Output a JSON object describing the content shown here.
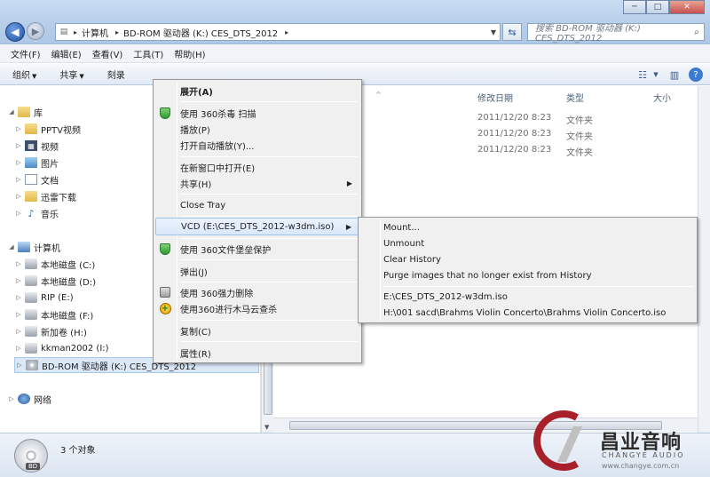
{
  "window": {
    "controls": [
      "─",
      "□",
      "✕"
    ]
  },
  "address_bar": {
    "crumbs": [
      "计算机",
      "BD-ROM 驱动器 (K:) CES_DTS_2012"
    ],
    "search_placeholder": "搜索 BD-ROM 驱动器 (K:) CES_DTS_2012"
  },
  "menubar": {
    "items": [
      "文件(F)",
      "编辑(E)",
      "查看(V)",
      "工具(T)",
      "帮助(H)"
    ]
  },
  "toolbar": {
    "organize": "组织",
    "share": "共享",
    "burn": "刻录"
  },
  "navpane": {
    "libraries": "库",
    "lib_items": [
      "PPTV视频",
      "视频",
      "图片",
      "文档",
      "迅雷下载",
      "音乐"
    ],
    "computer": "计算机",
    "drives": [
      "本地磁盘 (C:)",
      "本地磁盘 (D:)",
      "RIP (E:)",
      "本地磁盘 (F:)",
      "新加卷 (H:)",
      "kkman2002 (I:)",
      "BD-ROM 驱动器 (K:) CES_DTS_2012"
    ],
    "network": "网络"
  },
  "content": {
    "columns": {
      "date": "修改日期",
      "type": "类型",
      "size": "大小"
    },
    "rows": [
      {
        "date": "2011/12/20 8:23",
        "type": "文件夹"
      },
      {
        "date": "2011/12/20 8:23",
        "type": "文件夹"
      },
      {
        "date": "2011/12/20 8:23",
        "type": "文件夹"
      }
    ]
  },
  "context_menu": {
    "expand": "展开(A)",
    "scan360": "使用 360杀毒 扫描",
    "play": "播放(P)",
    "autoplay": "打开自动播放(Y)...",
    "open_new_window": "在新窗口中打开(E)",
    "share": "共享(H)",
    "close_tray": "Close Tray",
    "vcd": "VCD (E:\\CES_DTS_2012-w3dm.iso)",
    "vault360": "使用 360文件堡垒保护",
    "eject": "弹出(J)",
    "force_delete": "使用 360强力删除",
    "trojan_scan": "使用360进行木马云查杀",
    "copy": "复制(C)",
    "properties": "属性(R)"
  },
  "submenu": {
    "mount": "Mount...",
    "unmount": "Unmount",
    "clear_history": "Clear History",
    "purge": "Purge images that no longer exist from History",
    "history": [
      "E:\\CES_DTS_2012-w3dm.iso",
      "H:\\001 sacd\\Brahms Violin Concerto\\Brahms Violin Concerto.iso"
    ]
  },
  "statusbar": {
    "count": "3 个对象",
    "disc_badge": "BD"
  },
  "watermark": {
    "cn": "昌业音响",
    "en": "CHANGYE AUDIO",
    "url": "www.changye.com.cn"
  }
}
